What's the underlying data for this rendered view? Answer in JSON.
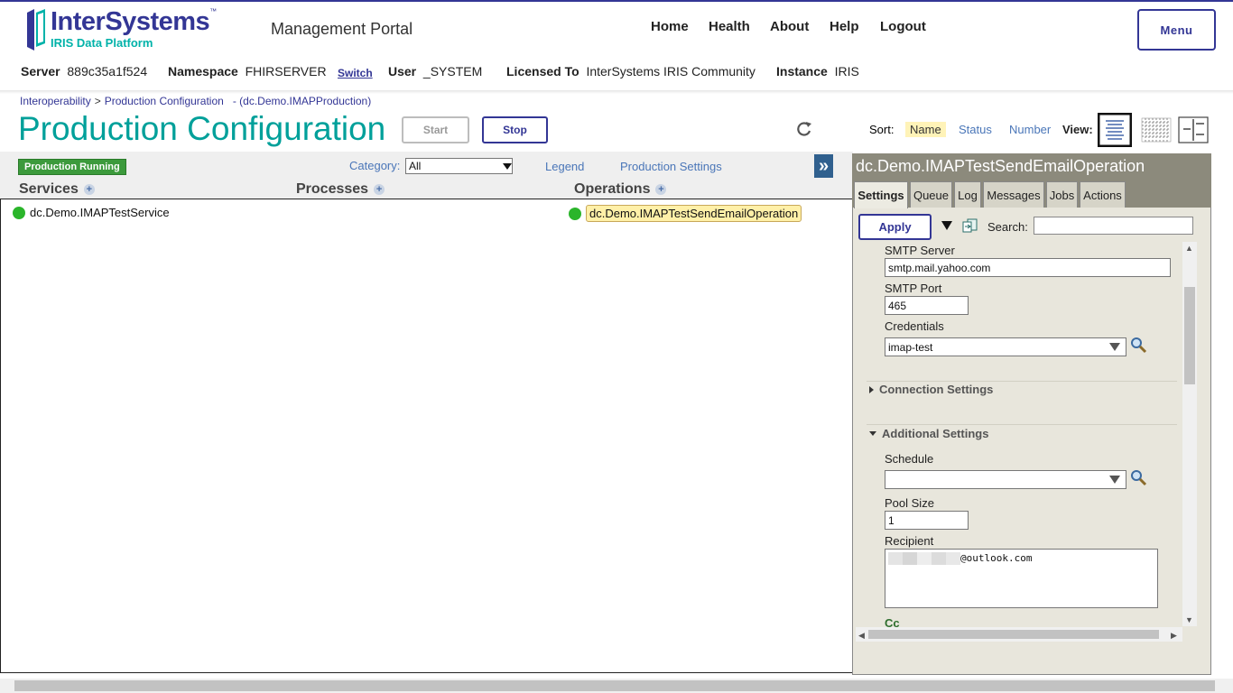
{
  "header": {
    "logo_name": "InterSystems",
    "logo_tm": "™",
    "logo_sub": "IRIS Data Platform",
    "portal_title": "Management Portal",
    "nav": [
      "Home",
      "Health",
      "About",
      "Help",
      "Logout"
    ],
    "menu_label": "Menu"
  },
  "info": {
    "server_label": "Server",
    "server_value": "889c35a1f524",
    "namespace_label": "Namespace",
    "namespace_value": "FHIRSERVER",
    "switch_label": "Switch",
    "user_label": "User",
    "user_value": "_SYSTEM",
    "licensed_label": "Licensed To",
    "licensed_value": "InterSystems IRIS Community",
    "instance_label": "Instance",
    "instance_value": "IRIS"
  },
  "breadcrumb": {
    "item1": "Interoperability",
    "separator": ">",
    "item2": "Production Configuration",
    "item3": "- (dc.Demo.IMAPProduction)"
  },
  "page": {
    "title": "Production Configuration",
    "start_label": "Start",
    "stop_label": "Stop"
  },
  "sort": {
    "label": "Sort:",
    "options": [
      "Name",
      "Status",
      "Number"
    ],
    "selected": "Name",
    "view_label": "View:"
  },
  "diagram": {
    "status_badge": "Production Running",
    "category_label": "Category:",
    "category_value": "All",
    "legend_link": "Legend",
    "settings_link": "Production Settings",
    "expand_glyph": "»",
    "columns": [
      "Services",
      "Processes",
      "Operations"
    ],
    "services": [
      "dc.Demo.IMAPTestService"
    ],
    "operations": [
      "dc.Demo.IMAPTestSendEmailOperation"
    ],
    "status_color": "#2bb52b"
  },
  "panel": {
    "title": "dc.Demo.IMAPTestSendEmailOperation",
    "tabs": [
      "Settings",
      "Queue",
      "Log",
      "Messages",
      "Jobs",
      "Actions"
    ],
    "active_tab": "Settings",
    "apply_label": "Apply",
    "search_label": "Search:",
    "search_value": "",
    "fields": {
      "smtp_server_label": "SMTP Server",
      "smtp_server_value": "smtp.mail.yahoo.com",
      "smtp_port_label": "SMTP Port",
      "smtp_port_value": "465",
      "credentials_label": "Credentials",
      "credentials_value": "imap-test",
      "connection_settings": "Connection Settings",
      "additional_settings": "Additional Settings",
      "schedule_label": "Schedule",
      "schedule_value": "",
      "pool_size_label": "Pool Size",
      "pool_size_value": "1",
      "recipient_label": "Recipient",
      "recipient_value": "@outlook.com",
      "cc_label": "Cc"
    }
  },
  "colors": {
    "brand_blue": "#333695",
    "brand_teal": "#00a09a",
    "link_blue": "#4a76b8",
    "running_green": "#3c9a3c"
  }
}
